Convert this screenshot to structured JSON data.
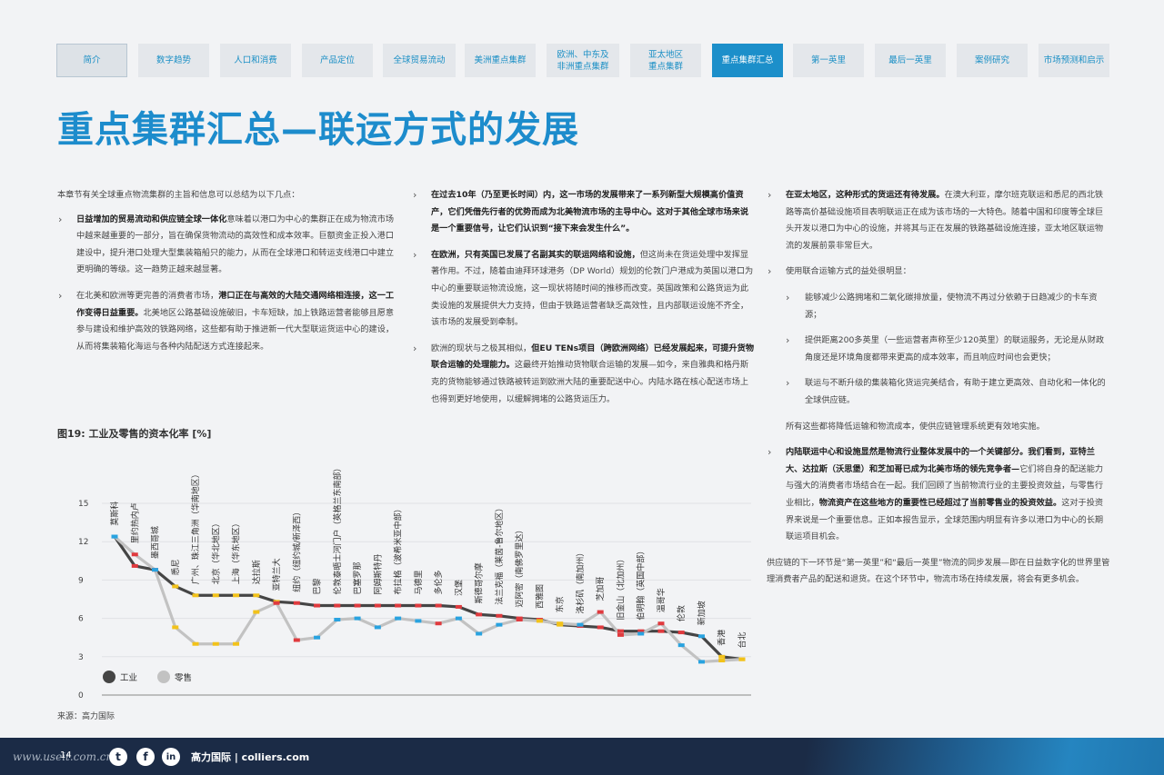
{
  "nav": [
    {
      "label": "简介",
      "active": false
    },
    {
      "label": "数字趋势",
      "active": false
    },
    {
      "label": "人口和消费",
      "active": false
    },
    {
      "label": "产品定位",
      "active": false
    },
    {
      "label": "全球贸易流动",
      "active": false
    },
    {
      "label": "美洲重点集群",
      "active": false
    },
    {
      "label": "欧洲、中东及\n非洲重点集群",
      "active": false
    },
    {
      "label": "亚太地区\n重点集群",
      "active": false
    },
    {
      "label": "重点集群汇总",
      "active": true
    },
    {
      "label": "第一英里",
      "active": false
    },
    {
      "label": "最后一英里",
      "active": false
    },
    {
      "label": "案例研究",
      "active": false
    },
    {
      "label": "市场预测和启示",
      "active": false
    }
  ],
  "title": "重点集群汇总—联运方式的发展",
  "col1": {
    "intro": "本章节有关全球重点物流集群的主旨和信息可以总结为以下几点：",
    "b1_bold": "日益增加的贸易流动和供应链全球一体化",
    "b1_text": "意味着以港口为中心的集群正在成为物流市场中越来越重要的一部分，旨在确保货物流动的高效性和成本效率。巨额资金正投入港口建设中，提升港口处理大型集装箱船只的能力，从而在全球港口和转运支线港口中建立更明确的等级。这一趋势正越来越显著。",
    "b2_pre": "在北美和欧洲等更完善的消费者市场，",
    "b2_bold": "港口正在与高效的大陆交通网络相连接，这一工作变得日益重要。",
    "b2_text": "北美地区公路基础设施破旧，卡车短缺，加上铁路运营者能够且愿意参与建设和维护高效的铁路网络，这些都有助于推进新一代大型联运货运中心的建设，从而将集装箱化海运与各种内陆配送方式连接起来。"
  },
  "col2": {
    "b1_bold": "在过去10年（乃至更长时间）内，这一市场的发展带来了一系列新型大规模高价值资产，它们凭借先行者的优势而成为北美物流市场的主导中心。这对于其他全球市场来说是一个重要信号，让它们认识到“接下来会发生什么”。",
    "b2_bold": "在欧洲，只有英国已发展了名副其实的联运网络和设施，",
    "b2_text": "但这尚未在货运处理中发挥显著作用。不过，随着由迪拜环球港务（DP World）规划的伦敦门户港成为英国以港口为中心的重要联运物流设施，这一现状将随时间的推移而改变。英国政策和公路货运为此类设施的发展提供大力支持，但由于铁路运营者缺乏高效性，且内部联运设施不齐全，该市场的发展受到牵制。",
    "b3_pre": "欧洲的现状与之极其相似，",
    "b3_bold": "但EU TENs项目（跨欧洲网络）已经发展起来，可提升货物联合运输的处理能力。",
    "b3_text": "这最终开始推动货物联合运输的发展—如今，来自雅典和格丹斯克的货物能够通过铁路被转运到欧洲大陆的重要配送中心。内陆水路在核心配送市场上也得到更好地使用，以缓解拥堵的公路货运压力。"
  },
  "col3": {
    "b1_bold": "在亚太地区，这种形式的货运还有待发展。",
    "b1_text": "在澳大利亚，摩尔班克联运和悉尼的西北铁路等高价基础设施项目表明联运正在成为该市场的一大特色。随着中国和印度等全球巨头开发以港口为中心的设施，并将其与正在发展的铁路基础设施连接，亚太地区联运物流的发展前景非常巨大。",
    "b2": "使用联合运输方式的益处很明显：",
    "s1": "能够减少公路拥堵和二氧化碳排放量，使物流不再过分依赖于日趋减少的卡车资源；",
    "s2": "提供距离200多英里（一些运营者声称至少120英里）的联运服务，无论是从财政角度还是环境角度都带来更高的成本效率，而且响应时间也会更快；",
    "s3": "联运与不断升级的集装箱化货运完美结合，有助于建立更高效、自动化和一体化的全球供应链。",
    "after": "所有这些都将降低运输和物流成本，使供应链管理系统更有效地实施。",
    "b3_bold1": "内陆联运中心和设施显然是物流行业整体发展中的一个关键部分。我们看到，亚特兰大、达拉斯（沃思堡）和芝加哥已成为北美市场的领先竞争者—",
    "b3_text1": "它们将自身的配送能力与强大的消费者市场结合在一起。我们回顾了当前物流行业的主要投资效益，与零售行业相比，",
    "b3_bold2": "物流资产在这些地方的重要性已经超过了当前零售业的投资效益。",
    "b3_text2": "这对于投资界来说是一个重要信息。正如本报告显示，全球范围内明显有许多以港口为中心的长期联运项目机会。",
    "closing": "供应链的下一环节是“第一英里”和“最后一英里”物流的同步发展—即在日益数字化的世界里管理消费者产品的配送和退货。在这个环节中，物流市场在持续发展，将会有更多机会。"
  },
  "figure": {
    "title": "图19: 工业及零售的资本化率 [%]",
    "source": "来源：高力国际"
  },
  "chart_data": {
    "type": "line",
    "title": "图19: 工业及零售的资本化率 [%]",
    "ylim": [
      0,
      15
    ],
    "yticks": [
      0,
      3,
      6,
      9,
      12,
      15
    ],
    "colors": {
      "industrial": "#4a4a4a",
      "retail": "#bfbfbf",
      "blue": "#29a3e0",
      "red": "#e03a3e",
      "yellow": "#f2c21a"
    },
    "categories": [
      "莫斯科",
      "里约热内卢",
      "墨西哥城",
      "悉尼",
      "广州、珠江三角洲（华南地区）",
      "北京（华北地区）",
      "上海（华东地区）",
      "达拉斯",
      "亚特兰大",
      "纽约（纽约城/新泽西）",
      "巴黎",
      "伦敦泰晤士河门户（英格兰东南部）",
      "巴塞罗那",
      "阿姆斯特丹",
      "布拉格（波希米亚中部）",
      "马德里",
      "多伦多",
      "汉堡",
      "斯德哥尔摩",
      "法兰克福（莱茵-鲁尔地区）",
      "迈阿密（南佛罗里达）",
      "西雅图",
      "东京",
      "洛杉矶（南加州）",
      "芝加哥",
      "旧金山（北加州）",
      "伯明翰（英国中部）",
      "温哥华",
      "伦敦",
      "新加坡",
      "香港",
      "台北"
    ],
    "series": [
      {
        "name": "工业",
        "marker_colors": [
          "blue",
          "red",
          "red",
          "yellow",
          "yellow",
          "yellow",
          "yellow",
          "yellow",
          "yellow",
          "red",
          "red",
          "red",
          "red",
          "red",
          "red",
          "red",
          "red",
          "red",
          "red",
          "red",
          "red",
          "red",
          "yellow",
          "red",
          "red",
          "red",
          "red",
          "red",
          "red",
          "blue",
          "yellow",
          "yellow"
        ],
        "values": [
          12.4,
          10.1,
          9.8,
          8.5,
          7.8,
          7.8,
          7.8,
          7.8,
          7.3,
          7.2,
          7.0,
          7.0,
          7.0,
          7.0,
          7.0,
          7.0,
          7.0,
          6.9,
          6.3,
          6.2,
          6.0,
          5.9,
          5.5,
          5.4,
          5.3,
          5.0,
          5.0,
          5.0,
          4.9,
          4.6,
          3.0,
          2.8
        ]
      },
      {
        "name": "零售",
        "marker_colors": [
          "blue",
          "red",
          "blue",
          "yellow",
          "yellow",
          "yellow",
          "yellow",
          "yellow",
          "red",
          "red",
          "blue",
          "blue",
          "blue",
          "blue",
          "blue",
          "blue",
          "red",
          "blue",
          "blue",
          "blue",
          "red",
          "yellow",
          "yellow",
          "blue",
          "red",
          "red",
          "blue",
          "red",
          "blue",
          "blue",
          "yellow",
          "yellow"
        ],
        "values": [
          12.4,
          11.0,
          9.8,
          5.3,
          4.0,
          4.0,
          4.0,
          6.5,
          7.2,
          4.3,
          4.5,
          5.9,
          6.0,
          5.3,
          6.0,
          5.8,
          5.6,
          6.0,
          4.8,
          5.5,
          5.9,
          5.8,
          5.6,
          5.5,
          6.5,
          4.7,
          4.8,
          5.6,
          3.9,
          2.6,
          2.7,
          2.8
        ]
      }
    ],
    "legend": [
      {
        "label": "工业"
      },
      {
        "label": "零售"
      }
    ],
    "legend_position": "bottom-left"
  },
  "footer": {
    "page": "14",
    "brand": "高力国际 | colliers.com",
    "watermark": "www.useit.com.cn",
    "social": [
      {
        "icon": "twitter-icon",
        "glyph": "t"
      },
      {
        "icon": "facebook-icon",
        "glyph": "f"
      },
      {
        "icon": "linkedin-icon",
        "glyph": "in"
      }
    ]
  }
}
